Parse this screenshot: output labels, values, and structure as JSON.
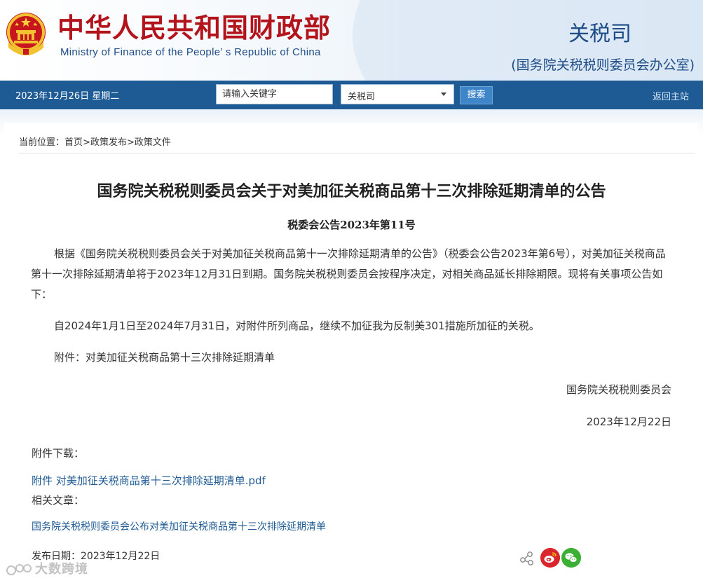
{
  "header": {
    "ministry_cn": "中华人民共和国财政部",
    "ministry_en": "Ministry of Finance of the People’ s Republic of China",
    "dept_title": "关税司",
    "dept_subtitle": "(国务院关税税则委员会办公室)"
  },
  "navbar": {
    "date": "2023年12月26日  星期二",
    "search_placeholder": "请输入关键字",
    "select_value": "关税司",
    "search_button": "搜索",
    "home_link": "返回主站"
  },
  "breadcrumb": {
    "prefix": "当前位置：",
    "items": [
      "首页",
      "政策发布",
      "政策文件"
    ],
    "separator": ">"
  },
  "article": {
    "title": "国务院关税税则委员会关于对美加征关税商品第十三次排除延期清单的公告",
    "doc_number": "税委会公告2023年第11号",
    "paragraphs": [
      "根据《国务院关税税则委员会关于对美加征关税商品第十一次排除延期清单的公告》（税委会公告2023年第6号），对美加征关税商品第十一次排除延期清单将于2023年12月31日到期。国务院关税税则委员会按程序决定，对相关商品延长排除期限。现将有关事项公告如下：",
      "自2024年1月1日至2024年7月31日，对附件所列商品，继续不加征我为反制美301措施所加征的关税。",
      "附件：对美加征关税商品第十三次排除延期清单"
    ],
    "signer": "国务院关税税则委员会",
    "sign_date": "2023年12月22日"
  },
  "attachments": {
    "label": "附件下载：",
    "link": "附件 对美加征关税商品第十三次排除延期清单.pdf"
  },
  "related": {
    "label": "相关文章：",
    "link": "国务院关税税则委员会公布对美加征关税商品第十三次排除延期清单"
  },
  "footer": {
    "publish_date": "发布日期：2023年12月22日",
    "watermark": "大数跨境"
  },
  "colors": {
    "brand_red": "#b3141c",
    "brand_blue": "#1e4c86",
    "nav_bg": "#1e5b95",
    "link": "#1f5a94"
  },
  "icons": {
    "emblem": "national-emblem-icon",
    "share": "share-icon",
    "weibo": "weibo-icon",
    "wechat": "wechat-icon"
  }
}
